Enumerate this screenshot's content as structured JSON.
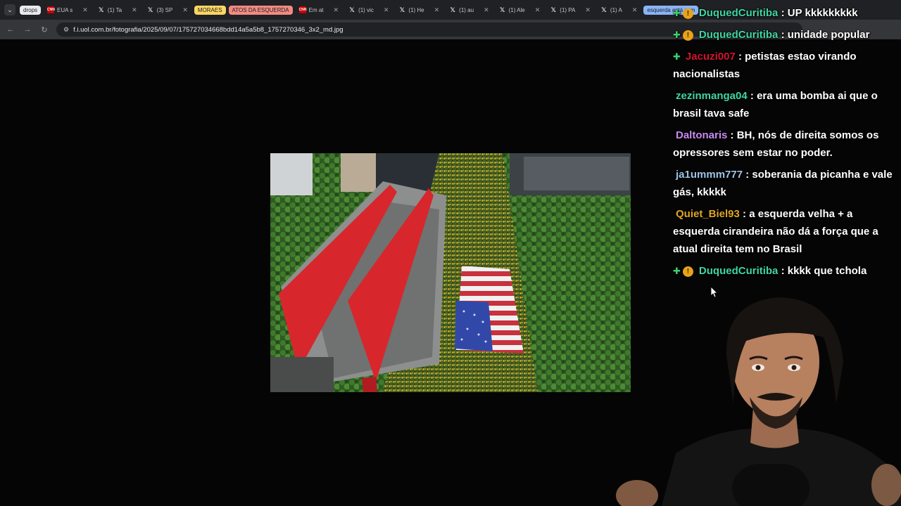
{
  "tabs": [
    {
      "kind": "group",
      "label": "drops",
      "color": "#e8eaed"
    },
    {
      "kind": "tab",
      "icon": "cnn",
      "label": "EUA s"
    },
    {
      "kind": "tab",
      "icon": "x",
      "label": "(1) Ta"
    },
    {
      "kind": "tab",
      "icon": "x",
      "label": "(3) SP"
    },
    {
      "kind": "group",
      "label": "MORAES",
      "color": "#fdd663"
    },
    {
      "kind": "group",
      "label": "ATOS DA ESQUERDA",
      "color": "#f28b82"
    },
    {
      "kind": "tab",
      "icon": "cnn",
      "label": "Em at"
    },
    {
      "kind": "tab",
      "icon": "x",
      "label": "(1) vic"
    },
    {
      "kind": "tab",
      "icon": "x",
      "label": "(1) He"
    },
    {
      "kind": "tab",
      "icon": "x",
      "label": "(1) au"
    },
    {
      "kind": "tab",
      "icon": "x",
      "label": "(1) Ale"
    },
    {
      "kind": "tab",
      "icon": "x",
      "label": "(1) PA"
    },
    {
      "kind": "tab",
      "icon": "x",
      "label": "(1) A"
    },
    {
      "kind": "group",
      "label": "esquerda está com",
      "color": "#8ab4f8"
    }
  ],
  "address": {
    "url": "f.i.uol.com.br/fotografia/2025/09/07/175727034668bdd14a5a5b8_1757270346_3x2_md.jpg"
  },
  "chat": [
    {
      "user": "DuquedCuritiba",
      "color": "#3fd6a2",
      "badges": [
        "plus",
        "coin"
      ],
      "text": "UP kkkkkkkkk"
    },
    {
      "user": "DuquedCuritiba",
      "color": "#3fd6a2",
      "badges": [
        "plus",
        "coin"
      ],
      "text": "unidade popular"
    },
    {
      "user": "Jacuzi007",
      "color": "#d2142f",
      "badges": [
        "plus"
      ],
      "text": "petistas estao virando nacionalistas"
    },
    {
      "user": "zezinmanga04",
      "color": "#3fd6a2",
      "badges": [],
      "text": "era uma bomba ai que o brasil tava safe"
    },
    {
      "user": "Daltonaris",
      "color": "#c98bf0",
      "badges": [],
      "text": "BH, nós de direita somos os opressores sem estar no poder."
    },
    {
      "user": "ja1ummm777",
      "color": "#9ec3e6",
      "badges": [],
      "text": "soberania da picanha e vale gás, kkkkk"
    },
    {
      "user": "Quiet_Biel93",
      "color": "#e0a526",
      "badges": [],
      "text": "a esquerda velha + a esquerda cirandeira não dá a força que a atual direita tem no Brasil"
    },
    {
      "user": "DuquedCuritiba",
      "color": "#3fd6a2",
      "badges": [
        "plus",
        "coin"
      ],
      "text": "kkkk que tchola"
    }
  ]
}
